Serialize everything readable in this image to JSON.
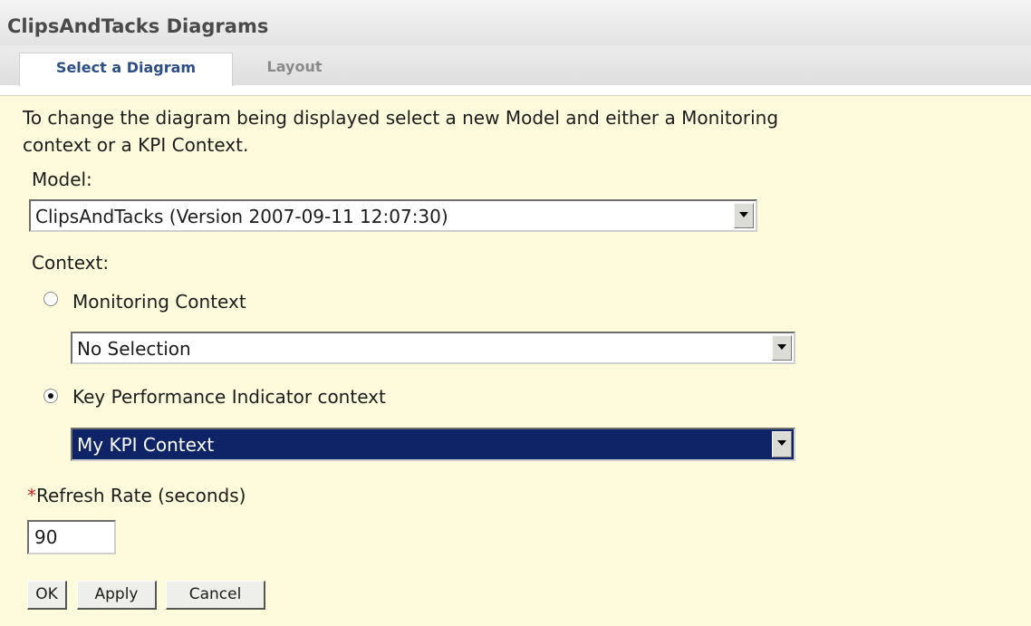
{
  "header": {
    "title": "ClipsAndTacks Diagrams"
  },
  "tabs": [
    {
      "label": "Select a Diagram",
      "active": true
    },
    {
      "label": "Layout",
      "active": false
    }
  ],
  "form": {
    "intro_line1": "To change the diagram being displayed select a new Model and either a Monitoring",
    "intro_line2": "context or a KPI Context.",
    "model_label": "Model:",
    "model_value": "ClipsAndTacks (Version 2007-09-11 12:07:30)",
    "context_label": "Context:",
    "monitoring_label": "Monitoring Context",
    "monitoring_value": "No Selection",
    "kpi_label": "Key Performance Indicator context",
    "kpi_value": "My KPI Context",
    "required_marker": "*",
    "refresh_label": "Refresh Rate (seconds)",
    "refresh_value": "90"
  },
  "buttons": {
    "ok": "OK",
    "apply": "Apply",
    "cancel": "Cancel"
  },
  "colors": {
    "content_bg": "#fdfbdc",
    "active_tab_text": "#2b4f86",
    "highlight_bg": "#0f2466",
    "required": "#cc2222"
  }
}
